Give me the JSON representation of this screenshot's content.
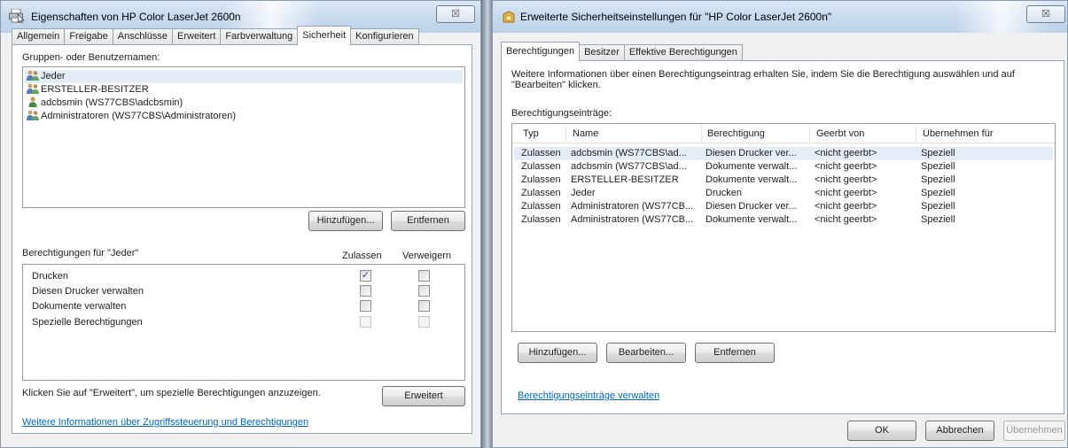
{
  "left": {
    "title": "Eigenschaften von HP Color LaserJet 2600n",
    "tabs": [
      "Allgemein",
      "Freigabe",
      "Anschlüsse",
      "Erweitert",
      "Farbverwaltung",
      "Sicherheit",
      "Konfigurieren"
    ],
    "active_tab": "Sicherheit",
    "groups_label": "Gruppen- oder Benutzernamen:",
    "users": [
      {
        "name": "Jeder",
        "icon": "group-icon"
      },
      {
        "name": "ERSTELLER-BESITZER",
        "icon": "group-icon"
      },
      {
        "name": "adcbsmin (WS77CBS\\adcbsmin)",
        "icon": "user-icon"
      },
      {
        "name": "Administratoren (WS77CBS\\Administratoren)",
        "icon": "group-icon"
      }
    ],
    "add_button": "Hinzufügen...",
    "remove_button": "Entfernen",
    "perm_label": "Berechtigungen für \"Jeder\"",
    "allow_header": "Zulassen",
    "deny_header": "Verweigern",
    "permissions": [
      {
        "name": "Drucken",
        "allow": true,
        "deny": false,
        "enabled": true
      },
      {
        "name": "Diesen Drucker verwalten",
        "allow": false,
        "deny": false,
        "enabled": true
      },
      {
        "name": "Dokumente verwalten",
        "allow": false,
        "deny": false,
        "enabled": true
      },
      {
        "name": "Spezielle Berechtigungen",
        "allow": false,
        "deny": false,
        "enabled": false
      }
    ],
    "advanced_hint": "Klicken Sie auf \"Erweitert\", um spezielle Berechtigungen anzuzeigen.",
    "advanced_button": "Erweitert",
    "info_link": "Weitere Informationen über Zugriffssteuerung und Berechtigungen",
    "close_glyph": "☒"
  },
  "right": {
    "title": "Erweiterte Sicherheitseinstellungen für \"HP Color LaserJet 2600n\"",
    "tabs": [
      "Berechtigungen",
      "Besitzer",
      "Effektive Berechtigungen"
    ],
    "active_tab": "Berechtigungen",
    "info_text_1": "Weitere Informationen über einen Berechtigungseintrag erhalten Sie, indem Sie die Berechtigung auswählen und auf",
    "info_text_2": "\"Bearbeiten\" klicken.",
    "entries_label": "Berechtigungseinträge:",
    "columns": [
      "Typ",
      "Name",
      "Berechtigung",
      "Geerbt von",
      "Übernehmen für"
    ],
    "rows": [
      [
        "Zulassen",
        "adcbsmin (WS77CBS\\ad...",
        "Diesen Drucker ver...",
        "<nicht geerbt>",
        "Speziell"
      ],
      [
        "Zulassen",
        "adcbsmin (WS77CBS\\ad...",
        "Dokumente verwalt...",
        "<nicht geerbt>",
        "Speziell"
      ],
      [
        "Zulassen",
        "ERSTELLER-BESITZER",
        "Dokumente verwalt...",
        "<nicht geerbt>",
        "Speziell"
      ],
      [
        "Zulassen",
        "Jeder",
        "Drucken",
        "<nicht geerbt>",
        "Speziell"
      ],
      [
        "Zulassen",
        "Administratoren (WS77CB...",
        "Diesen Drucker ver...",
        "<nicht geerbt>",
        "Speziell"
      ],
      [
        "Zulassen",
        "Administratoren (WS77CB...",
        "Dokumente verwalt...",
        "<nicht geerbt>",
        "Speziell"
      ]
    ],
    "add_button": "Hinzufügen...",
    "edit_button": "Bearbeiten...",
    "remove_button": "Entfernen",
    "manage_link": "Berechtigungseinträge verwalten",
    "ok_button": "OK",
    "cancel_button": "Abbrechen",
    "apply_button": "Übernehmen",
    "close_glyph": "☒"
  }
}
